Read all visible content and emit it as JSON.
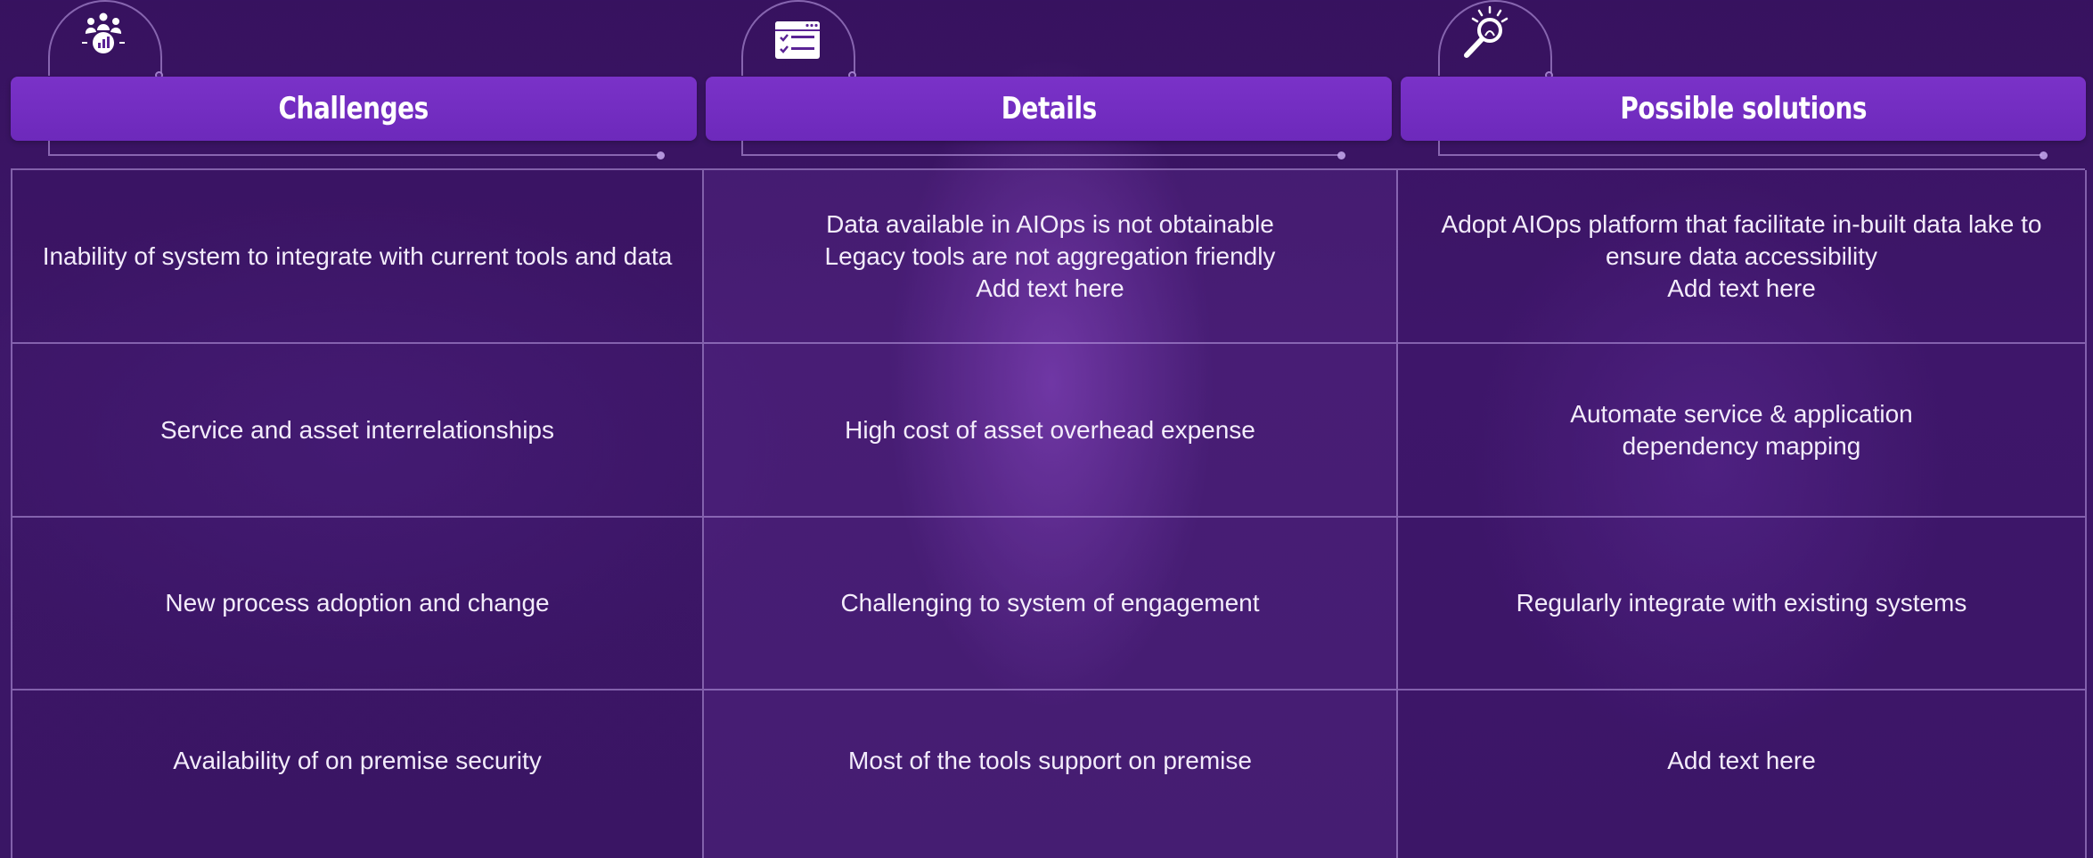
{
  "columns": [
    {
      "title": "Challenges",
      "icon": "team-analytics-icon"
    },
    {
      "title": "Details",
      "icon": "checklist-window-icon"
    },
    {
      "title": "Possible solutions",
      "icon": "lightbulb-search-icon"
    }
  ],
  "rows": [
    {
      "challenge": "Inability of system to integrate with current tools and data",
      "detail": "Data available in AIOps is not obtainable\nLegacy tools are not aggregation friendly\nAdd text here",
      "solution": "Adopt AIOps platform that facilitate in-built data lake to ensure data accessibility\nAdd text here"
    },
    {
      "challenge": "Service and asset interrelationships",
      "detail": "High cost of asset overhead expense",
      "solution": "Automate service & application\ndependency mapping"
    },
    {
      "challenge": "New process adoption and change",
      "detail": "Challenging to system of engagement",
      "solution": "Regularly  integrate with existing systems"
    },
    {
      "challenge": "Availability of on premise security",
      "detail": "Most of the tools support on premise",
      "solution": "Add text here"
    }
  ]
}
